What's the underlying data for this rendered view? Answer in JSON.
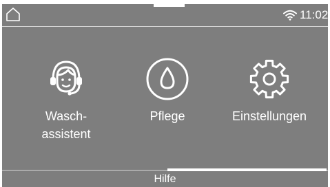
{
  "status_bar": {
    "home_icon": "home-icon",
    "wifi_icon": "wifi-icon",
    "time": "11:02"
  },
  "tiles": [
    {
      "icon": "headset-assistant-icon",
      "label_lines": [
        "Wasch-",
        "assistent"
      ]
    },
    {
      "icon": "water-drop-icon",
      "label_lines": [
        "Pflege"
      ]
    },
    {
      "icon": "gear-icon",
      "label_lines": [
        "Einstellungen"
      ]
    }
  ],
  "footer": {
    "help_label": "Hilfe"
  },
  "colors": {
    "background": "#7e7e7e",
    "foreground": "#ffffff",
    "divider": "#d8d8d8"
  }
}
